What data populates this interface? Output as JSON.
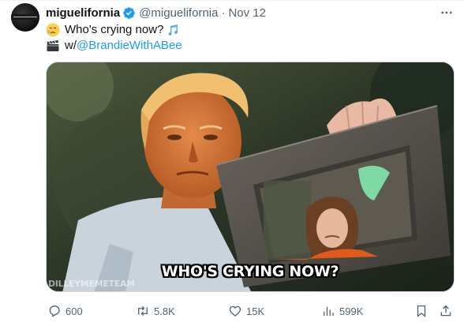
{
  "tweet": {
    "author_name": "miguelifornia",
    "handle": "@miguelifornia",
    "separator": "·",
    "date": "Nov 12",
    "line1_text": "Who's crying now?",
    "line2_prefix": "w/",
    "line2_mention": "@BrandieWithABee",
    "line1_emoji": "crying-face-emoji",
    "line2_emoji": "clapper-board-emoji",
    "notes_emoji": "musical-notes-emoji"
  },
  "media": {
    "caption": "WHO'S CRYING NOW?",
    "watermark": "DILLEYMEMETEAM"
  },
  "actions": {
    "replies": "600",
    "reposts": "5.8K",
    "likes": "15K",
    "views": "599K"
  },
  "colors": {
    "accent": "#1d9bf0",
    "secondary_text": "#536471",
    "primary_text": "#0f1419",
    "verified": "#1d9bf0"
  }
}
